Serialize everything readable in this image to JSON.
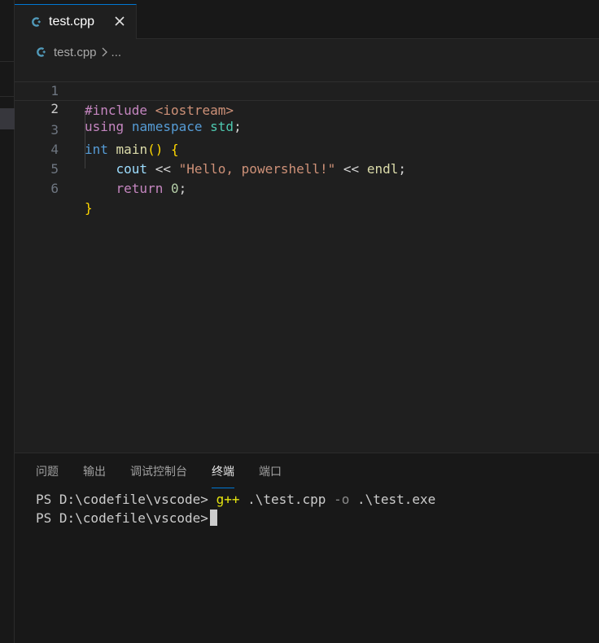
{
  "editor_tab": {
    "label": "test.cpp",
    "icon": "cpp-file-icon",
    "close_icon": "close-icon"
  },
  "breadcrumb": {
    "file": "test.cpp",
    "separator_icon": "chevron-right-icon",
    "more": "..."
  },
  "code": {
    "line_numbers": [
      "1",
      "2",
      "3",
      "4",
      "5",
      "6"
    ],
    "line1": {
      "directive": "#include",
      "header": "<iostream>"
    },
    "line2": {
      "using": "using",
      "namespace": "namespace",
      "std": "std",
      "semi": ";"
    },
    "line3": {
      "type": "int",
      "fn": "main",
      "parens": "()",
      "brace": "{"
    },
    "line4": {
      "indent": "    ",
      "cout": "cout",
      "op1": "<<",
      "str": "\"Hello, powershell!\"",
      "op2": "<<",
      "endl": "endl",
      "semi": ";"
    },
    "line5": {
      "indent": "    ",
      "ret": "return",
      "num": "0",
      "semi": ";"
    },
    "line6": {
      "brace": "}"
    }
  },
  "panel": {
    "tabs": [
      "问题",
      "输出",
      "调试控制台",
      "终端",
      "端口"
    ],
    "active_tab": "终端"
  },
  "terminal": {
    "line1": {
      "prompt": "PS D:\\codefile\\vscode>",
      "cmd": "g++",
      "arg1": ".\\test.cpp",
      "flag": "-o",
      "arg2": ".\\test.exe"
    },
    "line2": {
      "prompt": "PS D:\\codefile\\vscode>"
    }
  },
  "colors": {
    "accent": "#0078d4",
    "background": "#1f1f1f",
    "panel": "#181818"
  }
}
